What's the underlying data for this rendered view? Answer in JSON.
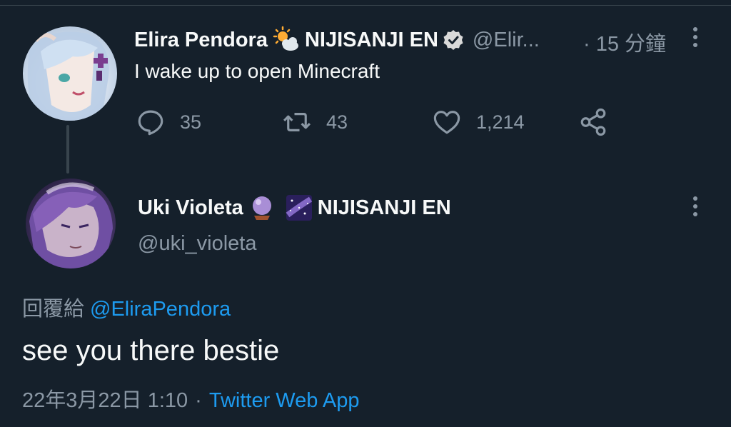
{
  "parent_tweet": {
    "display_name": "Elira Pendora",
    "affiliation": "NIJISANJI EN",
    "handle": "@Elir...",
    "time": "· 15 分鐘",
    "text": "I wake up to open Minecraft",
    "icons": [
      "sun-behind-cloud-emoji",
      "verified-badge-icon"
    ],
    "actions": {
      "reply_count": "35",
      "retweet_count": "43",
      "like_count": "1,214"
    }
  },
  "reply_tweet": {
    "display_name": "Uki Violeta",
    "affiliation": "NIJISANJI EN",
    "handle": "@uki_violeta",
    "icons": [
      "crystal-ball-emoji",
      "milky-way-emoji"
    ],
    "reply_to_label": "回覆給",
    "reply_to_mention": "@EliraPendora",
    "text": "see you there bestie",
    "timestamp": "22年3月22日 1:10",
    "separator": "·",
    "source": "Twitter Web App"
  },
  "colors": {
    "background": "#15202b",
    "text_primary": "#f7f9f9",
    "text_secondary": "#8b98a5",
    "accent": "#1d9bf0",
    "divider": "#38444d"
  }
}
